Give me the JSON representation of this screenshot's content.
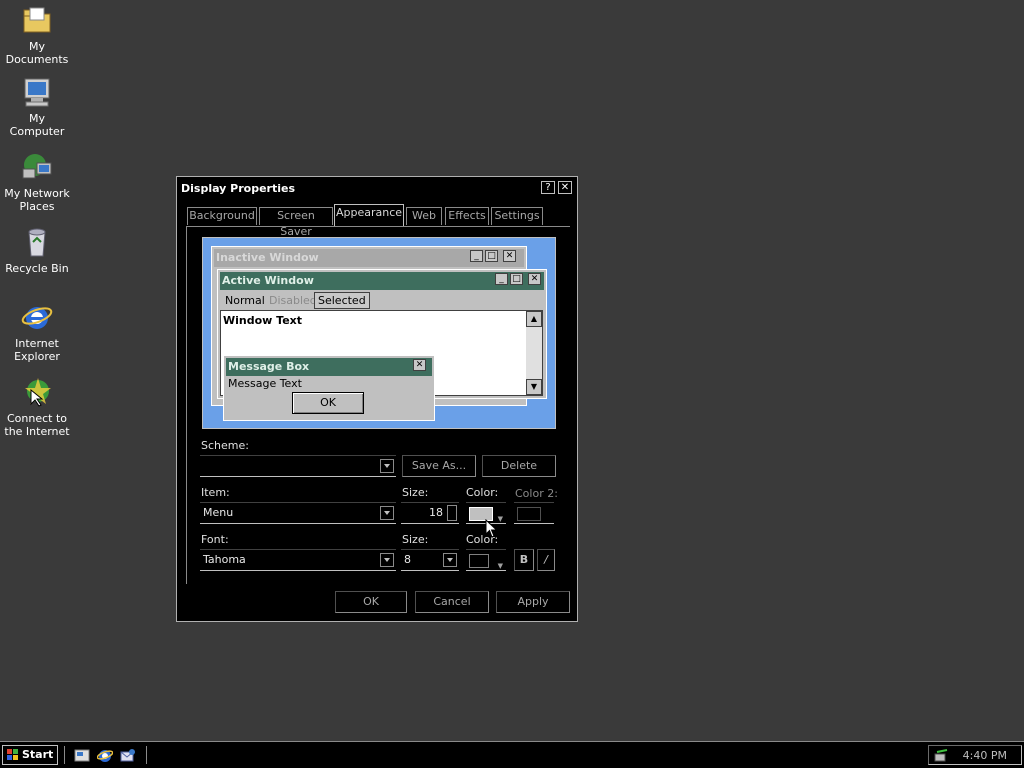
{
  "desktop": {
    "icons": [
      {
        "label": "My Documents",
        "icon": "folder-documents-icon"
      },
      {
        "label": "My Computer",
        "icon": "computer-icon"
      },
      {
        "label": "My Network Places",
        "icon": "network-icon"
      },
      {
        "label": "Recycle Bin",
        "icon": "recycle-bin-icon"
      },
      {
        "label": "Internet Explorer",
        "icon": "internet-explorer-icon"
      },
      {
        "label": "Connect to the Internet",
        "icon": "connect-internet-icon"
      }
    ]
  },
  "dialog": {
    "title": "Display Properties",
    "help_glyph": "?",
    "close_glyph": "✕",
    "tabs": [
      "Background",
      "Screen Saver",
      "Appearance",
      "Web",
      "Effects",
      "Settings"
    ],
    "active_tab": "Appearance",
    "preview": {
      "inactive_title": "Inactive Window",
      "active_title": "Active Window",
      "menu_normal": "Normal",
      "menu_disabled": "Disabled",
      "menu_selected": "Selected",
      "window_text": "Window Text",
      "msgbox_title": "Message Box",
      "msgbox_text": "Message Text",
      "msgbox_ok": "OK",
      "colors": {
        "inactive_title": "#a8a8a8",
        "active_title": "#3e6e5e",
        "desktop": "#6aa0e8"
      }
    },
    "scheme_label": "Scheme:",
    "scheme_value": "",
    "save_as": "Save As...",
    "delete": "Delete",
    "item_label": "Item:",
    "item_value": "Menu",
    "size_label": "Size:",
    "item_size": "18",
    "color_label": "Color:",
    "color2_label": "Color 2:",
    "font_label": "Font:",
    "font_value": "Tahoma",
    "font_size_label": "Size:",
    "font_size": "8",
    "font_color_label": "Color:",
    "bold": "B",
    "italic": "/",
    "ok": "OK",
    "cancel": "Cancel",
    "apply": "Apply"
  },
  "taskbar": {
    "start": "Start",
    "clock": "4:40 PM",
    "quicklaunch": [
      "show-desktop-icon",
      "internet-explorer-icon",
      "outlook-express-icon"
    ]
  }
}
